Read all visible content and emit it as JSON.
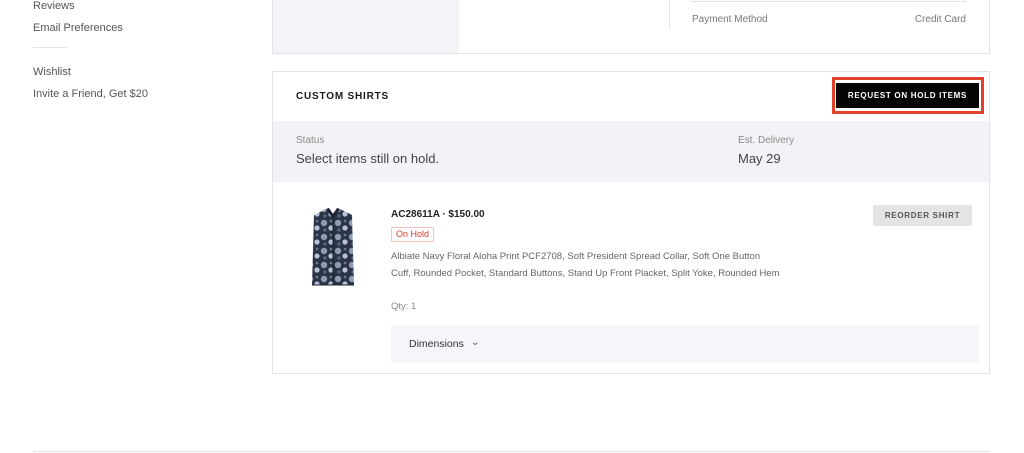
{
  "sidebar": {
    "items": [
      {
        "label": "Reviews"
      },
      {
        "label": "Email Preferences"
      },
      {
        "label": "Wishlist"
      },
      {
        "label": "Invite a Friend, Get $20"
      }
    ]
  },
  "previous_order": {
    "payment_method_label": "Payment Method",
    "payment_method_value": "Credit Card"
  },
  "custom_shirts": {
    "title": "CUSTOM SHIRTS",
    "request_button_label": "REQUEST ON HOLD ITEMS",
    "status_label": "Status",
    "status_value": "Select items still on hold.",
    "est_delivery_label": "Est. Delivery",
    "est_delivery_value": "May 29",
    "item": {
      "sku_price": "AC28611A · $150.00",
      "badge": "On Hold",
      "description": "Albiate Navy Floral Aloha Print PCF2708, Soft President Spread Collar, Soft One Button Cuff, Rounded Pocket, Standard Buttons, Stand Up Front Placket, Split Yoke, Rounded Hem",
      "qty": "Qty: 1",
      "reorder_button_label": "REORDER SHIRT",
      "dimensions_label": "Dimensions",
      "dimensions_icon": "chevron-down-icon"
    }
  },
  "colors": {
    "highlight": "#e0412c",
    "primary_button": "#050505",
    "badge_red": "#d2402d",
    "band_bg": "#f3f3f7"
  }
}
